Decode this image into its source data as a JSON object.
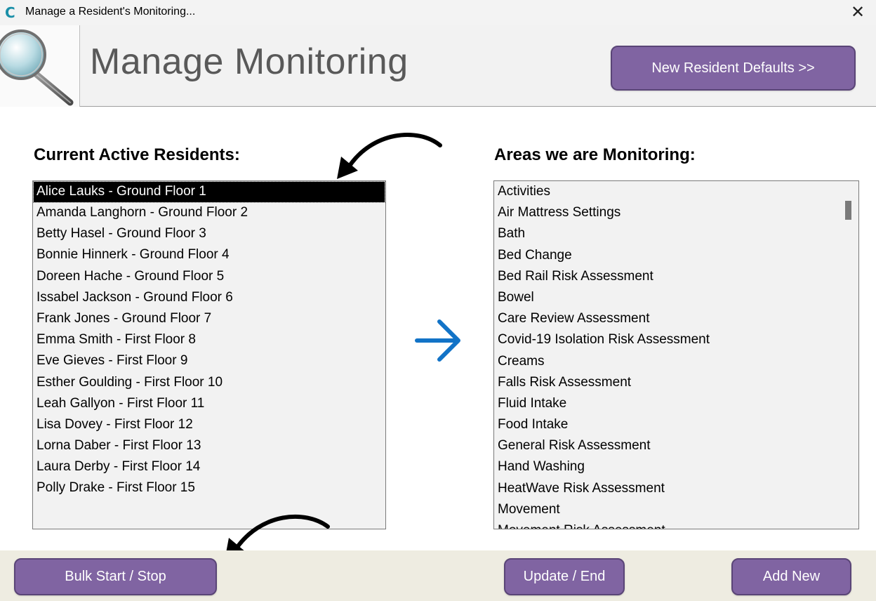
{
  "window": {
    "title": "Manage a Resident's Monitoring...",
    "app_icon_glyph": "C",
    "close_glyph": "✕"
  },
  "header": {
    "logo_icon": "magnifying-glass-icon",
    "title": "Manage Monitoring",
    "defaults_button_label": "New Resident Defaults >>"
  },
  "residents": {
    "label": "Current Active Residents:",
    "selected_index": 0,
    "items": [
      "Alice Lauks - Ground Floor 1",
      "Amanda Langhorn - Ground Floor 2",
      "Betty Hasel - Ground Floor 3",
      "Bonnie Hinnerk - Ground Floor 4",
      "Doreen Hache - Ground Floor 5",
      "Issabel Jackson - Ground Floor 6",
      "Frank Jones - Ground Floor 7",
      "Emma Smith - First Floor 8",
      "Eve Gieves - First Floor 9",
      "Esther Goulding - First Floor 10",
      "Leah Gallyon - First Floor 11",
      "Lisa Dovey - First Floor 12",
      "Lorna Daber - First Floor 13",
      "Laura Derby - First Floor 14",
      "Polly Drake - First Floor 15"
    ]
  },
  "areas": {
    "label": "Areas we are Monitoring:",
    "items": [
      "Activities",
      "Air Mattress Settings",
      "Bath",
      "Bed Change",
      "Bed Rail Risk Assessment",
      "Bowel",
      "Care Review Assessment",
      "Covid-19 Isolation Risk Assessment",
      "Creams",
      "Falls Risk Assessment",
      "Fluid Intake",
      "Food Intake",
      "General Risk Assessment",
      "Hand Washing",
      "HeatWave Risk Assessment",
      "Movement",
      "Movement Risk Assessment"
    ]
  },
  "footer": {
    "bulk_label": "Bulk Start / Stop",
    "update_label": "Update / End",
    "add_new_label": "Add New"
  },
  "colors": {
    "button_purple": "#8064a2",
    "footer_bg": "#eeece1",
    "header_bg": "#f2f2f2",
    "arrow_blue": "#1273c7"
  }
}
